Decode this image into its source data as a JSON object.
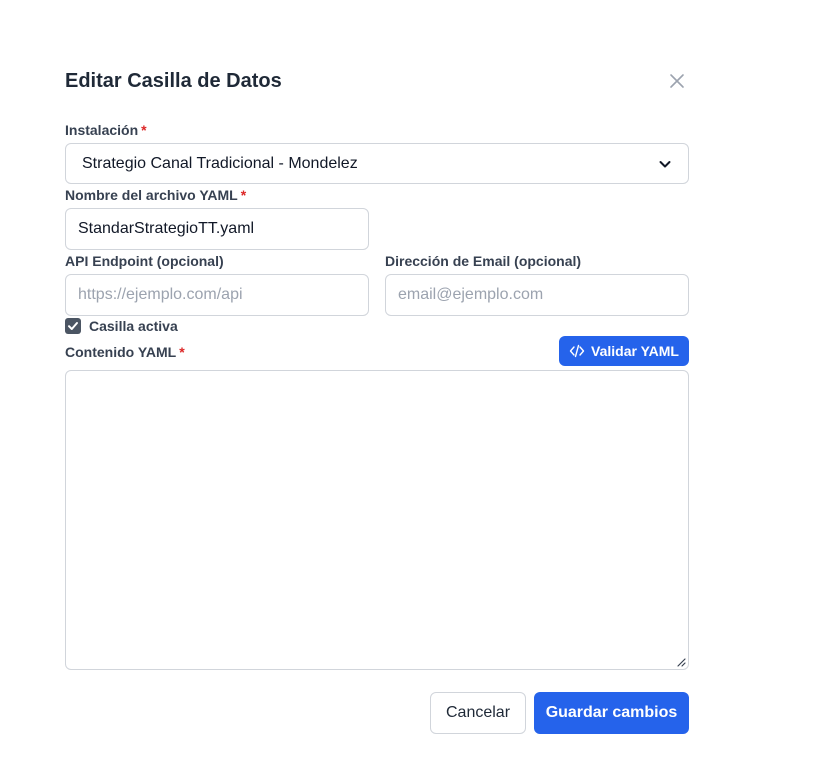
{
  "dialog": {
    "title": "Editar Casilla de Datos",
    "close_icon": "close-icon"
  },
  "form": {
    "installation": {
      "label": "Instalación",
      "required_mark": "*",
      "selected_value": "Strategio Canal Tradicional - Mondelez"
    },
    "yaml_filename": {
      "label": "Nombre del archivo YAML",
      "required_mark": "*",
      "value": "StandarStrategioTT.yaml"
    },
    "api_endpoint": {
      "label": "API Endpoint (opcional)",
      "placeholder": "https://ejemplo.com/api",
      "value": ""
    },
    "email": {
      "label": "Dirección de Email (opcional)",
      "placeholder": "email@ejemplo.com",
      "value": ""
    },
    "active": {
      "label": "Casilla activa",
      "checked": true
    },
    "yaml_content": {
      "label": "Contenido YAML",
      "required_mark": "*",
      "value": "",
      "validate_button": "Validar YAML",
      "validate_icon": "code-icon"
    }
  },
  "footer": {
    "cancel_label": "Cancelar",
    "save_label": "Guardar cambios"
  },
  "colors": {
    "primary": "#2563eb",
    "required": "#dc2626",
    "border": "#d1d5db",
    "checkbox": "#4b5563"
  }
}
